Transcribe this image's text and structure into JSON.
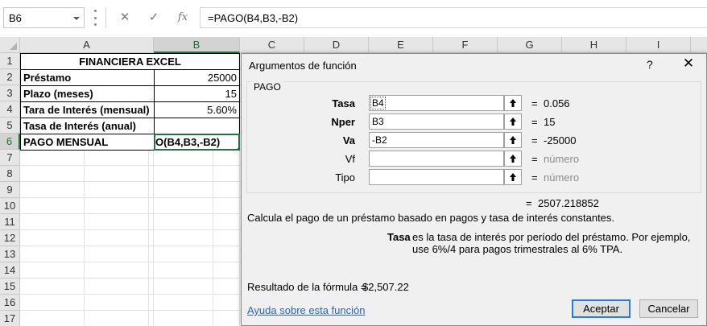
{
  "formula_bar": {
    "name_box": "B6",
    "cancel_icon": "✕",
    "enter_icon": "✓",
    "fx_label": "fx",
    "formula": "=PAGO(B4,B3,-B2)"
  },
  "sheet": {
    "columns": [
      "A",
      "B",
      "C",
      "D",
      "E",
      "F",
      "G",
      "H",
      "I"
    ],
    "rows": [
      "1",
      "2",
      "3",
      "4",
      "5",
      "6",
      "7",
      "8",
      "9",
      "10",
      "11",
      "12",
      "13",
      "14",
      "15",
      "16",
      "17"
    ],
    "title": "FINANCIERA EXCEL",
    "cells": [
      {
        "label": "Préstamo",
        "value": "25000"
      },
      {
        "label": "Plazo (meses)",
        "value": "15"
      },
      {
        "label": "Tara de Interés (mensual)",
        "value": "5.60%"
      },
      {
        "label": "Tasa de Interés (anual)",
        "value": ""
      },
      {
        "label": "PAGO MENSUAL",
        "value": "O(B4,B3,-B2)"
      }
    ]
  },
  "dialog": {
    "title": "Argumentos de función",
    "help_icon": "?",
    "close_icon": "✕",
    "function_name": "PAGO",
    "args": [
      {
        "label": "Tasa",
        "value": "B4",
        "result": "0.056"
      },
      {
        "label": "Nper",
        "value": "B3",
        "result": "15"
      },
      {
        "label": "Va",
        "value": "-B2",
        "result": "-25000"
      },
      {
        "label": "Vf",
        "value": "",
        "result": "número"
      },
      {
        "label": "Tipo",
        "value": "",
        "result": "número"
      }
    ],
    "equals": "=",
    "function_result": "2507.218852",
    "description": "Calcula el pago de un préstamo basado en pagos y tasa de interés constantes.",
    "arg_help_name": "Tasa",
    "arg_help_text": "es la tasa de interés por período del préstamo. Por ejemplo, use 6%/4 para pagos trimestrales al 6% TPA.",
    "formula_result_label": "Resultado de la fórmula =",
    "formula_result_value": "$2,507.22",
    "help_link": "Ayuda sobre esta función",
    "ok_label": "Aceptar",
    "cancel_label": "Cancelar"
  },
  "colors": {
    "excel_green": "#217346",
    "link_blue": "#2b62c4",
    "focus_blue": "#2a7bd5"
  }
}
